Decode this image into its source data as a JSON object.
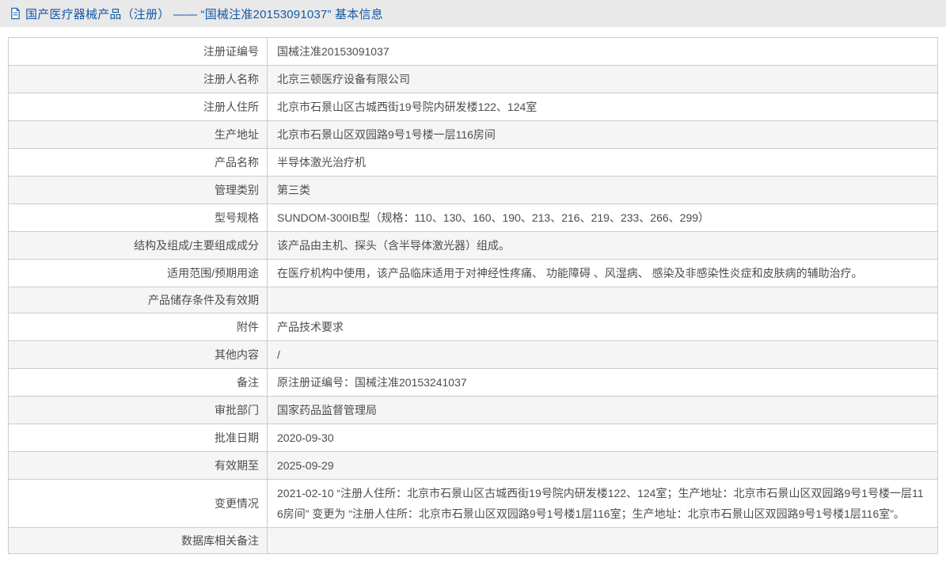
{
  "header": {
    "title": "国产医疗器械产品（注册） —— “国械注准20153091037” 基本信息",
    "icon": "document-icon"
  },
  "colors": {
    "title_blue": "#1558a6",
    "icon_blue": "#2a6fba",
    "topbar_bg": "#e9e9e9",
    "row_alt_bg": "#f5f5f5",
    "border": "#cccccc",
    "text": "#4d4d4d"
  },
  "table": {
    "rows": [
      {
        "label": "注册证编号",
        "value": "国械注准20153091037"
      },
      {
        "label": "注册人名称",
        "value": "北京三顿医疗设备有限公司"
      },
      {
        "label": "注册人住所",
        "value": "北京市石景山区古城西街19号院内研发楼122、124室"
      },
      {
        "label": "生产地址",
        "value": "北京市石景山区双园路9号1号楼一层116房间"
      },
      {
        "label": "产品名称",
        "value": "半导体激光治疗机"
      },
      {
        "label": "管理类别",
        "value": "第三类"
      },
      {
        "label": "型号规格",
        "value": "SUNDOM-300IB型（规格：110、130、160、190、213、216、219、233、266、299）"
      },
      {
        "label": "结构及组成/主要组成成分",
        "value": "该产品由主机、探头（含半导体激光器）组成。"
      },
      {
        "label": "适用范围/预期用途",
        "value": "在医疗机构中使用，该产品临床适用于对神经性疼痛、 功能障碍 、风湿病、 感染及非感染性炎症和皮肤病的辅助治疗。"
      },
      {
        "label": "产品储存条件及有效期",
        "value": ""
      },
      {
        "label": "附件",
        "value": "产品技术要求"
      },
      {
        "label": "其他内容",
        "value": "/"
      },
      {
        "label": "备注",
        "value": "原注册证编号：国械注准20153241037"
      },
      {
        "label": "审批部门",
        "value": "国家药品监督管理局"
      },
      {
        "label": "批准日期",
        "value": "2020-09-30"
      },
      {
        "label": "有效期至",
        "value": "2025-09-29"
      },
      {
        "label": "变更情况",
        "value": "2021-02-10 “注册人住所：北京市石景山区古城西街19号院内研发楼122、124室；生产地址：北京市石景山区双园路9号1号楼一层116房间” 变更为 “注册人住所：北京市石景山区双园路9号1号楼1层116室；生产地址：北京市石景山区双园路9号1号楼1层116室”。"
      },
      {
        "label": "数据库相关备注",
        "value": ""
      }
    ]
  }
}
